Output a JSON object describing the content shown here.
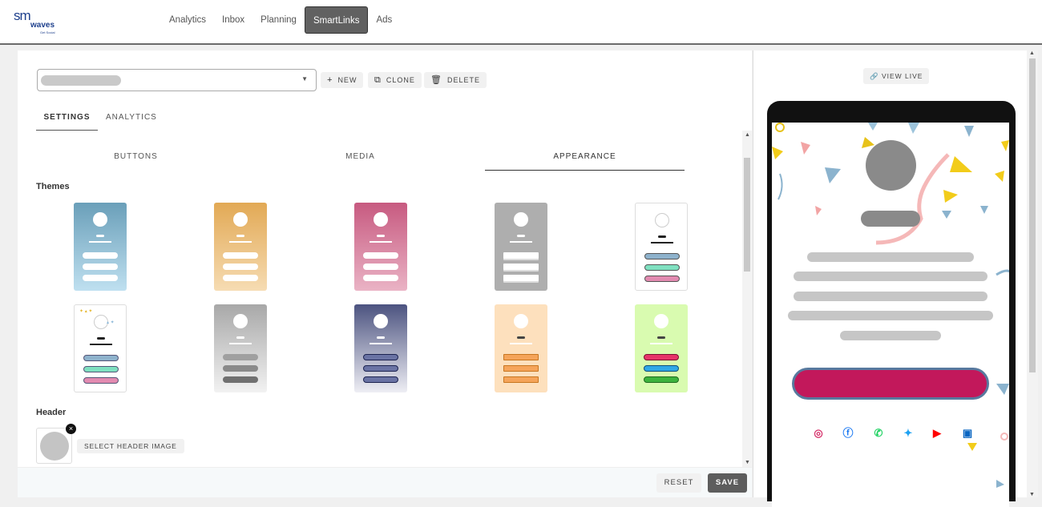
{
  "brand": {
    "logo_text_1": "sm",
    "logo_text_2": "waves",
    "logo_sub": "Get Social"
  },
  "nav": {
    "tabs": [
      "Analytics",
      "Inbox",
      "Planning",
      "SmartLinks",
      "Ads"
    ],
    "active": "SmartLinks"
  },
  "toolbar": {
    "new_label": "NEW",
    "clone_label": "CLONE",
    "delete_label": "DELETE"
  },
  "main_tabs": {
    "settings": "SETTINGS",
    "analytics": "ANALYTICS",
    "active": "SETTINGS"
  },
  "sub_tabs": {
    "buttons": "BUTTONS",
    "media": "MEDIA",
    "appearance": "APPEARANCE",
    "active": "APPEARANCE"
  },
  "sections": {
    "themes": "Themes",
    "header": "Header"
  },
  "header_section": {
    "select_label": "SELECT HEADER IMAGE"
  },
  "footer": {
    "reset_label": "RESET",
    "save_label": "SAVE"
  },
  "preview": {
    "view_live_label": "VIEW LIVE",
    "cta_color": "#c2185b"
  },
  "themes": [
    {
      "id": "blue-gradient",
      "bg": "linear-gradient(#6a9fb9,#bfe0f0)",
      "btn": "#fff"
    },
    {
      "id": "orange-gradient",
      "bg": "linear-gradient(#e2a955,#f6dcb3)",
      "btn": "#fff"
    },
    {
      "id": "pink-gradient",
      "bg": "linear-gradient(#c75a80,#eab3c5)",
      "btn": "#fff"
    },
    {
      "id": "gray-flat",
      "bg": "#aeaeae",
      "btn": "#fff"
    },
    {
      "id": "white-pastel",
      "bg": "#fff",
      "btn": "pastel"
    },
    {
      "id": "confetti",
      "bg": "#fff",
      "btn": "confetti"
    },
    {
      "id": "gray-gradient",
      "bg": "linear-gradient(#a8a8a8,#f2f2f2)",
      "btn": "#9a9a9a"
    },
    {
      "id": "navy-gradient",
      "bg": "linear-gradient(#4c5380,#eeeef4)",
      "btn": "#6a73a4"
    },
    {
      "id": "peach",
      "bg": "#fde0bd",
      "btn": "#f5a45a"
    },
    {
      "id": "lime",
      "bg": "#d9fbb0",
      "btn": "lime"
    }
  ]
}
